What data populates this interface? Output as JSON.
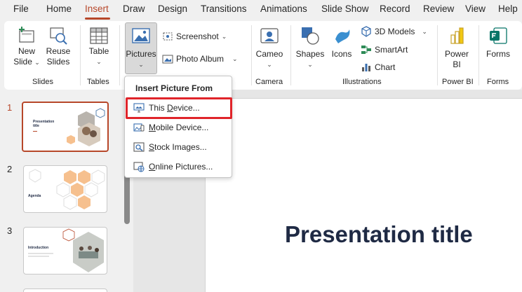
{
  "menu": {
    "tabs": [
      "File",
      "Home",
      "Insert",
      "Draw",
      "Design",
      "Transitions",
      "Animations",
      "Slide Show",
      "Record",
      "Review",
      "View",
      "Help"
    ],
    "active": "Insert"
  },
  "ribbon": {
    "new_slide": {
      "line1": "New",
      "line2": "Slide"
    },
    "reuse_slides": {
      "line1": "Reuse",
      "line2": "Slides"
    },
    "table": "Table",
    "pictures": "Pictures",
    "screenshot": "Screenshot",
    "photo_album": "Photo Album",
    "cameo": "Cameo",
    "shapes": "Shapes",
    "icons": "Icons",
    "models_3d": "3D Models",
    "smartart": "SmartArt",
    "chart": "Chart",
    "power_bi": {
      "line1": "Power",
      "line2": "BI"
    },
    "forms": "Forms",
    "groups": {
      "slides": "Slides",
      "tables": "Tables",
      "camera": "Camera",
      "illustrations": "Illustrations",
      "power_bi": "Power BI",
      "forms": "Forms"
    }
  },
  "dropdown": {
    "header": "Insert Picture From",
    "items": [
      {
        "pre": "This ",
        "ul": "D",
        "post": "evice..."
      },
      {
        "pre": "",
        "ul": "M",
        "post": "obile Device..."
      },
      {
        "pre": "",
        "ul": "S",
        "post": "tock Images..."
      },
      {
        "pre": "",
        "ul": "O",
        "post": "nline Pictures..."
      }
    ]
  },
  "thumbnails": {
    "numbers": [
      "1",
      "2",
      "3"
    ],
    "slide1_title": "Presentation title",
    "slide2_title": "Agenda",
    "slide3_title": "Introduction"
  },
  "slide": {
    "title": "Presentation title"
  },
  "colors": {
    "accent": "#b7472a",
    "highlight": "#e0242a",
    "title": "#1f2a44",
    "hex_orange": "#f6c08e"
  }
}
